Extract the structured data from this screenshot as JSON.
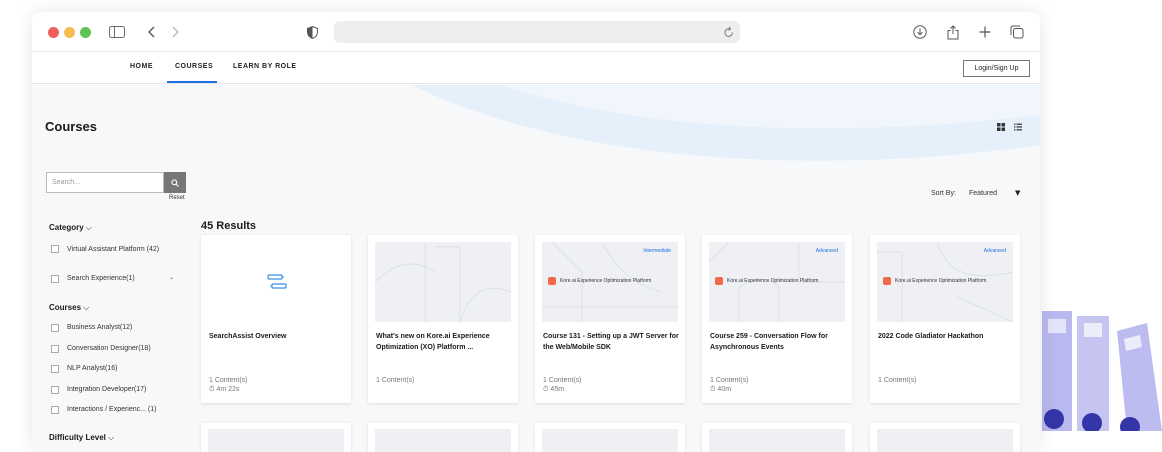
{
  "browser": {
    "traffic_lights": [
      "#ee5f57",
      "#f5bd4f",
      "#5fc454"
    ],
    "icons": [
      "sidebar-icon",
      "back-icon",
      "forward-icon",
      "shield-icon",
      "reload-icon",
      "download-icon",
      "share-icon",
      "new-tab-icon",
      "tabs-icon"
    ]
  },
  "nav": {
    "items": [
      {
        "label": "HOME"
      },
      {
        "label": "COURSES",
        "active": true
      },
      {
        "label": "LEARN BY ROLE"
      }
    ],
    "login_label": "Login/Sign Up",
    "accent": "#1f6fe5"
  },
  "page": {
    "title": "Courses",
    "search_placeholder": "Search...",
    "reset_label": "Reset",
    "sort_label": "Sort By:",
    "sort_value": "Featured",
    "results_label": "45 Results"
  },
  "filters": {
    "category": {
      "heading": "Category",
      "items": [
        "Virtual Assistant Platform (42)",
        "Search Experience(1)"
      ]
    },
    "courses": {
      "heading": "Courses",
      "items": [
        "Business Analyst(12)",
        "Conversation Designer(18)",
        "NLP Analyst(16)",
        "Integration Developer(17)",
        "Interactions / Experienc... (1)"
      ]
    },
    "difficulty": {
      "heading": "Difficulty Level"
    }
  },
  "cards": [
    {
      "title": "SearchAssist Overview",
      "contents": "1 Content(s)",
      "duration": "4m 22s",
      "level": "",
      "brand": ""
    },
    {
      "title": "What's new on Kore.ai Experience Optimization (XO) Platform ...",
      "contents": "1 Content(s)",
      "duration": "",
      "level": "",
      "brand": ""
    },
    {
      "title": "Course 131 - Setting up a JWT Server for the Web/Mobile SDK",
      "contents": "1 Content(s)",
      "duration": "45m",
      "level": "Intermediate",
      "brand": "Kore.ai Experience Optimization Platform"
    },
    {
      "title": "Course 259 - Conversation Flow for Asynchronous Events",
      "contents": "1 Content(s)",
      "duration": "40m",
      "level": "Advanced",
      "brand": "Kore.ai Experience Optimization Platform"
    },
    {
      "title": "2022 Code Gladiator Hackathon",
      "contents": "1 Content(s)",
      "duration": "",
      "level": "Advanced",
      "brand": "Kore.ai Experience Optimization Platform"
    }
  ]
}
